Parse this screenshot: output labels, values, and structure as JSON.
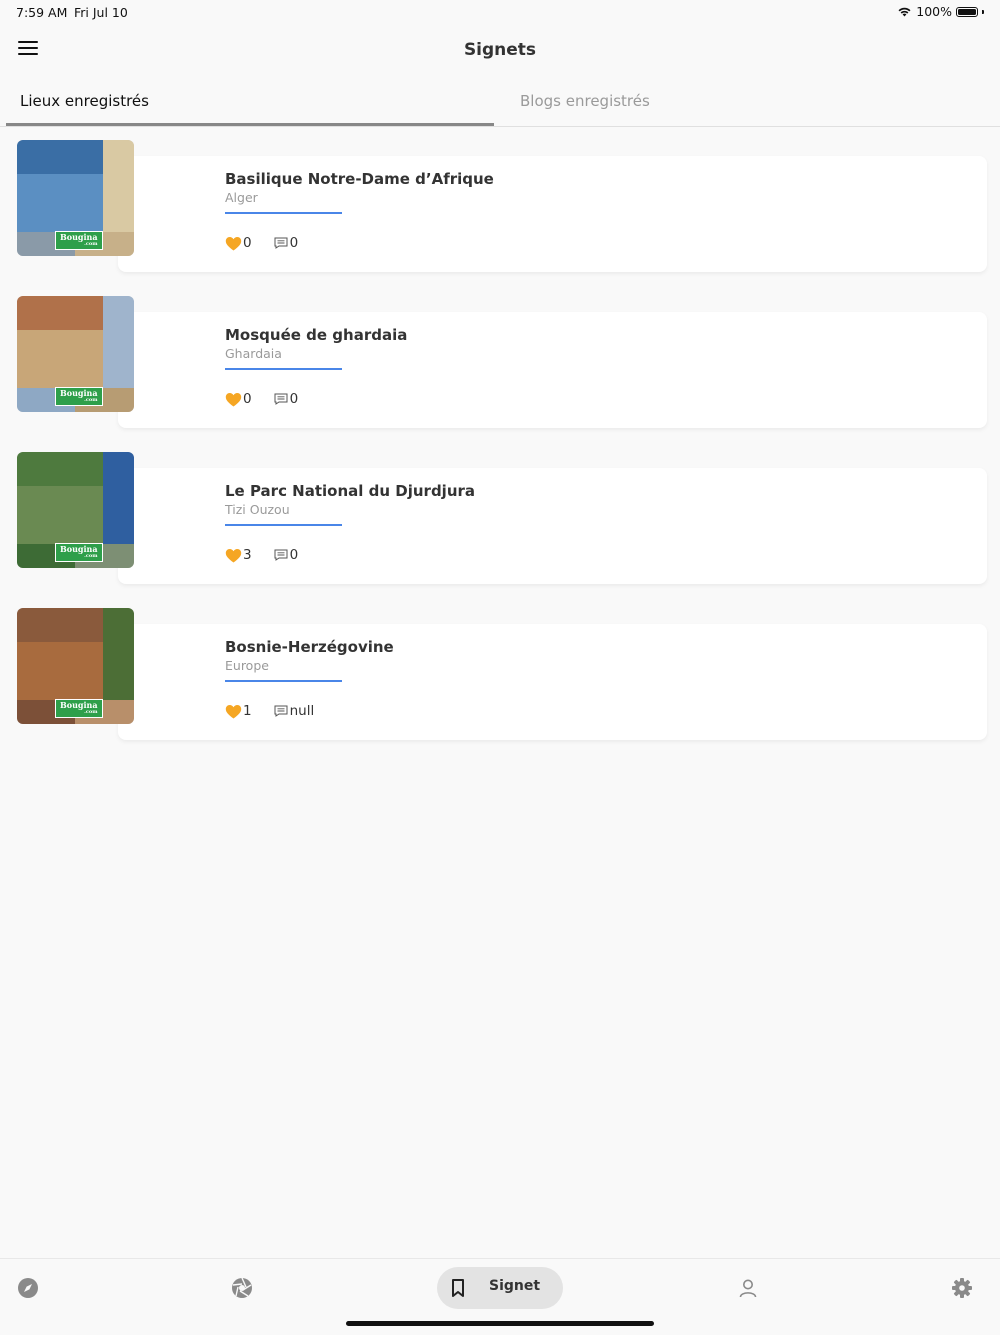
{
  "status_bar": {
    "time": "7:59 AM",
    "date": "Fri Jul 10",
    "battery": "100%"
  },
  "header": {
    "title": "Signets"
  },
  "tabs": [
    {
      "label": "Lieux enregistrés",
      "active": true
    },
    {
      "label": "Blogs enregistrés",
      "active": false
    }
  ],
  "places": [
    {
      "title": "Basilique Notre-Dame d’Afrique",
      "location": "Alger",
      "likes": "0",
      "comments": "0",
      "badge": "Bougina",
      "badge_sub": ".com",
      "palette": [
        "#3a6ea5",
        "#d9c9a3",
        "#5b8fc2",
        "#8a9aa8",
        "#c7b089"
      ]
    },
    {
      "title": "Mosquée de ghardaia",
      "location": "Ghardaia",
      "likes": "0",
      "comments": "0",
      "badge": "Bougina",
      "badge_sub": ".com",
      "palette": [
        "#b0714a",
        "#9fb4cc",
        "#c8a678",
        "#8ea8c4",
        "#b79c73"
      ]
    },
    {
      "title": "Le Parc National du Djurdjura",
      "location": "Tizi Ouzou",
      "likes": "3",
      "comments": "0",
      "badge": "Bougina",
      "badge_sub": ".com",
      "palette": [
        "#4e7a3e",
        "#2f5fa0",
        "#6a8a52",
        "#3d6b35",
        "#7d8f74"
      ]
    },
    {
      "title": "Bosnie-Herzégovine",
      "location": "Europe",
      "likes": "1",
      "comments": "null",
      "badge": "Bougina",
      "badge_sub": ".com",
      "palette": [
        "#8a5a3c",
        "#4c6e36",
        "#a86b3e",
        "#7c5038",
        "#b88f6a"
      ]
    }
  ],
  "bottom_nav": {
    "active_label": "Signet",
    "items": [
      "explore-icon",
      "aperture-icon",
      "bookmark-icon",
      "user-icon",
      "settings-icon"
    ]
  },
  "colors": {
    "accent_line": "#4a86e8",
    "heart": "#f5a623",
    "badge": "#2e9f4a"
  }
}
